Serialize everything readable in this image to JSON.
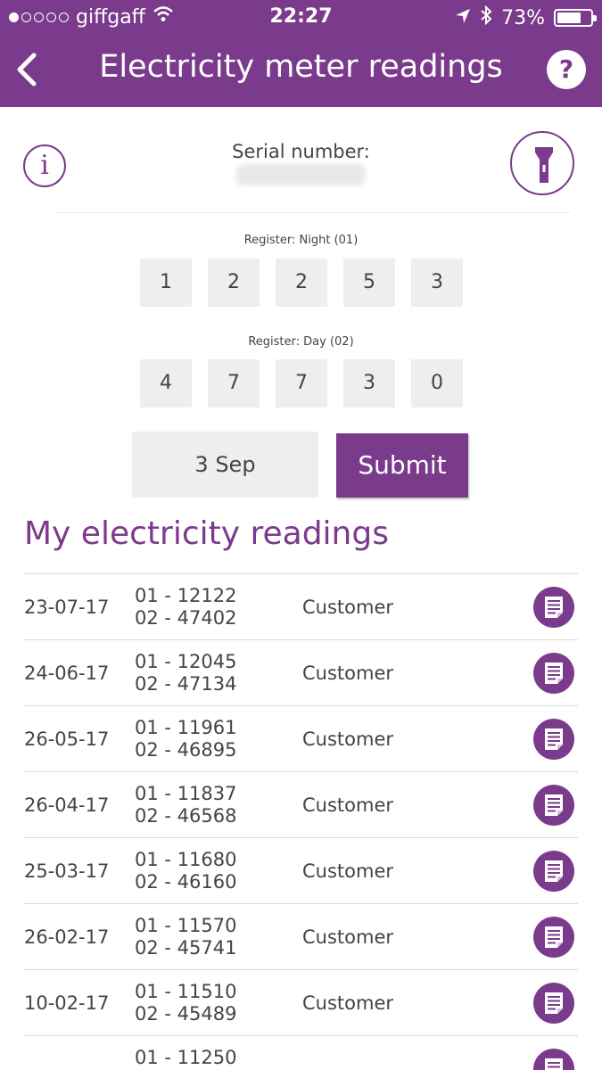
{
  "status_bar": {
    "carrier": "giffgaff",
    "time": "22:27",
    "battery_text": "73%",
    "battery_level": 0.73,
    "signal_bars_filled": 1,
    "signal_bars_total": 5
  },
  "header": {
    "title": "Electricity meter readings",
    "help_label": "?"
  },
  "serial": {
    "label": "Serial number:",
    "info_label": "i"
  },
  "registers": [
    {
      "label": "Register: Night (01)",
      "digits": [
        "1",
        "2",
        "2",
        "5",
        "3"
      ]
    },
    {
      "label": "Register: Day (02)",
      "digits": [
        "4",
        "7",
        "7",
        "3",
        "0"
      ]
    }
  ],
  "form": {
    "date_value": "3 Sep",
    "submit_label": "Submit"
  },
  "readings_section": {
    "title": "My electricity readings",
    "rows": [
      {
        "date": "23-07-17",
        "r01": "01 - 12122",
        "r02": "02 - 47402",
        "source": "Customer"
      },
      {
        "date": "24-06-17",
        "r01": "01 - 12045",
        "r02": "02 - 47134",
        "source": "Customer"
      },
      {
        "date": "26-05-17",
        "r01": "01 - 11961",
        "r02": "02 - 46895",
        "source": "Customer"
      },
      {
        "date": "26-04-17",
        "r01": "01 - 11837",
        "r02": "02 - 46568",
        "source": "Customer"
      },
      {
        "date": "25-03-17",
        "r01": "01 - 11680",
        "r02": "02 - 46160",
        "source": "Customer"
      },
      {
        "date": "26-02-17",
        "r01": "01 - 11570",
        "r02": "02 - 45741",
        "source": "Customer"
      },
      {
        "date": "10-02-17",
        "r01": "01 - 11510",
        "r02": "02 - 45489",
        "source": "Customer"
      },
      {
        "date": "",
        "r01": "01 - 11250",
        "r02": "",
        "source": ""
      }
    ]
  },
  "colors": {
    "brand": "#7b3b8c",
    "button_gray": "#eeeeee"
  },
  "icons": {
    "back": "chevron-left-icon",
    "help": "question-icon",
    "info": "info-icon",
    "torch": "torch-icon",
    "reading_doc": "document-icon"
  }
}
